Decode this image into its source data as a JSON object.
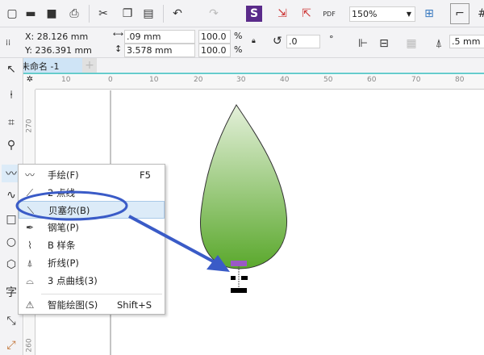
{
  "toolbar": {
    "zoom": "150%",
    "icons": [
      "new-doc",
      "open",
      "save",
      "print",
      "cut",
      "copy",
      "paste",
      "undo",
      "redo",
      "app-launcher",
      "import",
      "export",
      "publish-pdf",
      "full-screen",
      "snap"
    ]
  },
  "propbar": {
    "x": "X: 28.126 mm",
    "y": "Y: 236.391 mm",
    "width": ".09 mm",
    "height": "3.578 mm",
    "scale_x": "100.0",
    "scale_y": "100.0",
    "pct": "%",
    "angle": ".0",
    "deg": "°",
    "outline": ".5 mm"
  },
  "tabs": {
    "doc": "未命名 -1",
    "add": "+"
  },
  "ruler": {
    "h": [
      "10",
      "0",
      "10",
      "20",
      "30",
      "40",
      "50",
      "60",
      "70",
      "80"
    ],
    "v": [
      "270",
      "260"
    ]
  },
  "toolbox": {
    "text_tool": "字"
  },
  "menu": {
    "items": [
      {
        "label": "手绘(F)",
        "shortcut": "F5",
        "icon": "freehand-icon"
      },
      {
        "label": "2 点线",
        "shortcut": "",
        "icon": "two-point-line-icon"
      },
      {
        "label": "贝塞尔(B)",
        "shortcut": "",
        "icon": "bezier-icon",
        "highlighted": true
      },
      {
        "label": "钢笔(P)",
        "shortcut": "",
        "icon": "pen-icon"
      },
      {
        "label": "B 样条",
        "shortcut": "",
        "icon": "b-spline-icon"
      },
      {
        "label": "折线(P)",
        "shortcut": "",
        "icon": "polyline-icon"
      },
      {
        "label": "3 点曲线(3)",
        "shortcut": "",
        "icon": "three-point-curve-icon"
      },
      {
        "label": "智能绘图(S)",
        "shortcut": "Shift+S",
        "icon": "smart-drawing-icon"
      }
    ]
  },
  "colors": {
    "annotation": "#3a5bc7",
    "leaf_top": "#e4f0da",
    "leaf_bottom": "#5aa82c",
    "node": "#9b59c6"
  }
}
